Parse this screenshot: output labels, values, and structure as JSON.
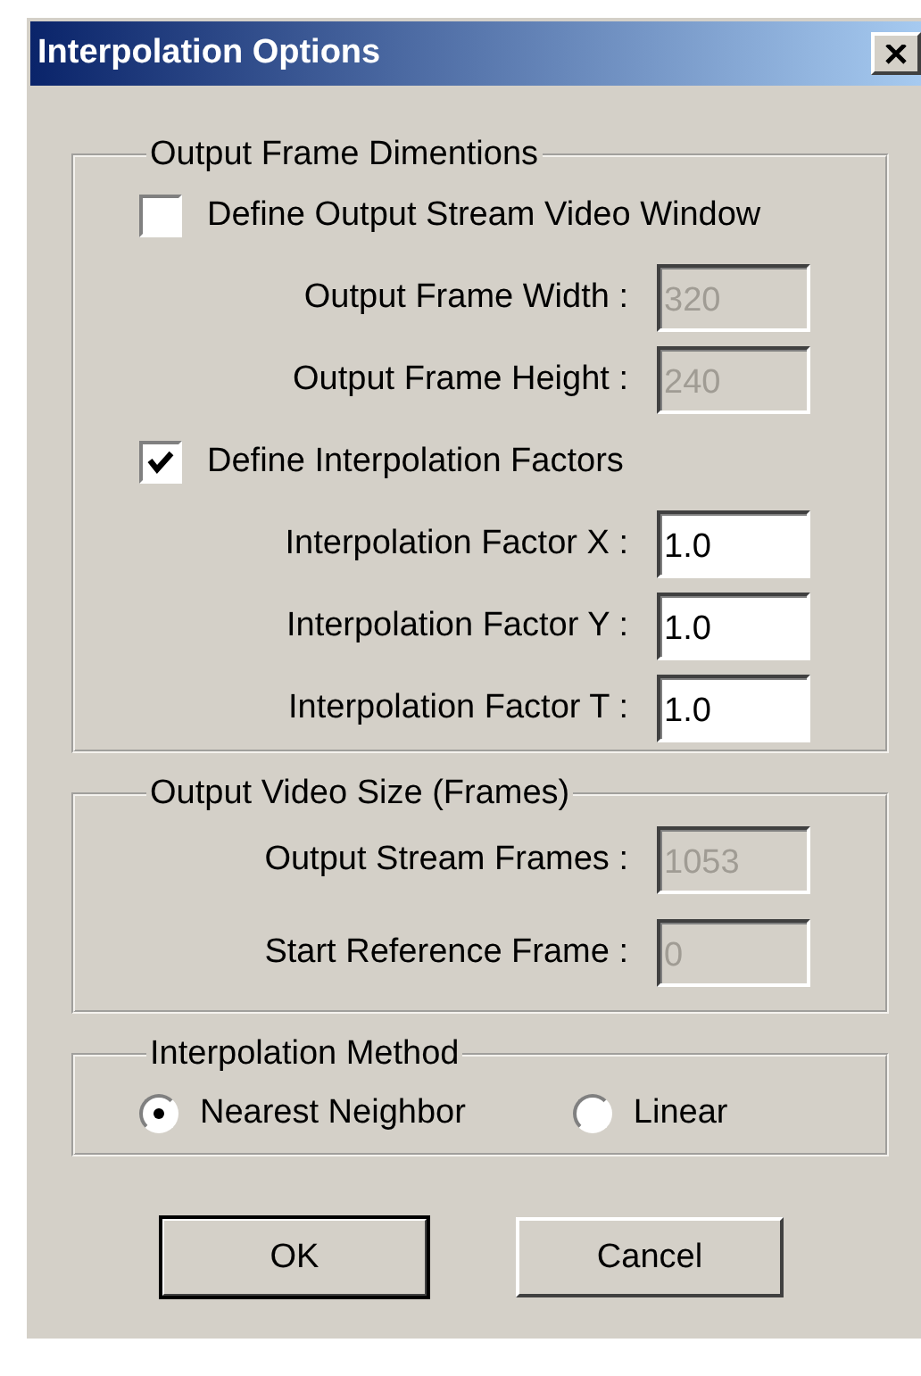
{
  "window": {
    "title": "Interpolation Options"
  },
  "groups": [
    {
      "legend": "Output Frame Dimentions",
      "items": [
        {
          "kind": "checkbox",
          "label": "Define Output Stream Video Window",
          "checked": false
        },
        {
          "kind": "field",
          "label": "Output Frame Width :",
          "value": "320",
          "disabled": true
        },
        {
          "kind": "field",
          "label": "Output Frame Height :",
          "value": "240",
          "disabled": true
        },
        {
          "kind": "checkbox",
          "label": "Define Interpolation Factors",
          "checked": true
        },
        {
          "kind": "field",
          "label": "Interpolation Factor X :",
          "value": "1.0",
          "disabled": false
        },
        {
          "kind": "field",
          "label": "Interpolation Factor Y :",
          "value": "1.0",
          "disabled": false
        },
        {
          "kind": "field",
          "label": "Interpolation Factor T :",
          "value": "1.0",
          "disabled": false
        }
      ]
    },
    {
      "legend": "Output Video Size (Frames)",
      "items": [
        {
          "kind": "field",
          "label": "Output Stream Frames :",
          "value": "1053",
          "disabled": true
        },
        {
          "kind": "field",
          "label": "Start Reference Frame :",
          "value": "0",
          "disabled": true
        }
      ]
    },
    {
      "legend": "Interpolation Method",
      "items": [
        {
          "kind": "radios",
          "options": [
            {
              "label": "Nearest Neighbor",
              "selected": true
            },
            {
              "label": "Linear",
              "selected": false
            }
          ]
        }
      ]
    }
  ],
  "buttons": [
    {
      "label": "OK",
      "default": true
    },
    {
      "label": "Cancel",
      "default": false
    }
  ]
}
